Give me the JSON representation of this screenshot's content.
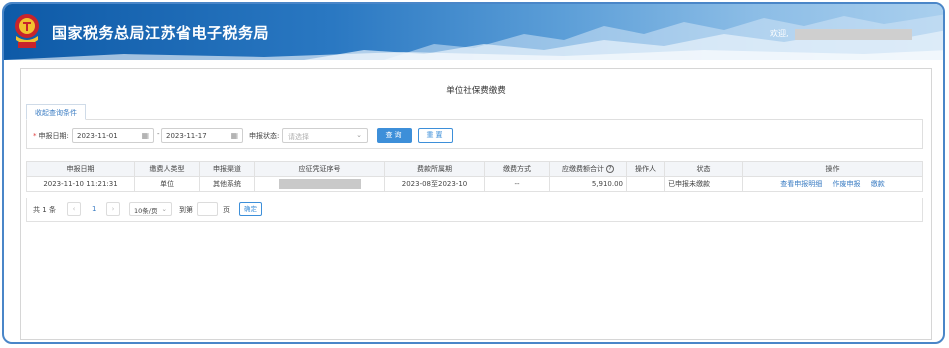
{
  "header": {
    "site_title": "国家税务总局江苏省电子税务局",
    "welcome": "欢迎,"
  },
  "page": {
    "title": "单位社保费缴费",
    "collapse_tab": "收起查询条件"
  },
  "filters": {
    "date_label": "申报日期:",
    "date_from": "2023-11-01",
    "date_separator": "-",
    "date_to": "2023-11-17",
    "status_label": "申报状态:",
    "status_placeholder": "请选择",
    "query_button": "查询",
    "reset_button": "重置"
  },
  "table": {
    "columns": [
      "申报日期",
      "缴费人类型",
      "申报渠道",
      "应征凭证序号",
      "费款所属期",
      "缴费方式",
      "应缴费额合计",
      "操作人",
      "状态",
      "操作"
    ],
    "rows": [
      {
        "date": "2023-11-10 11:21:31",
        "payer_type": "单位",
        "channel": "其他系统",
        "voucher": "",
        "period": "2023-08至2023-10",
        "payment_method": "--",
        "amount": "5,910.00",
        "operator": "",
        "status": "已申报未缴款",
        "actions": [
          "查看申报明细",
          "作废申报",
          "缴款"
        ]
      }
    ]
  },
  "pager": {
    "total_prefix": "共",
    "total_count": "1",
    "total_suffix": "条",
    "prev": "‹",
    "current_page": "1",
    "next": "›",
    "page_size": "10条/页",
    "goto_prefix": "到第",
    "goto_suffix": "页",
    "confirm": "确定"
  },
  "colors": {
    "accent": "#3d8fd9",
    "link": "#3a7cc3",
    "required": "#e03c3c"
  }
}
